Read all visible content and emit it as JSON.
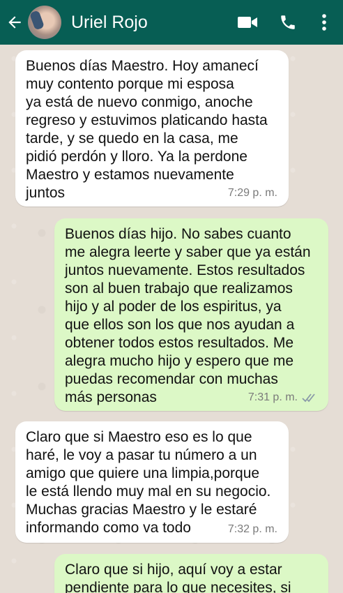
{
  "header": {
    "contact_name": "Uriel Rojo",
    "bg_color": "#075e54",
    "icons": [
      "back-arrow-icon",
      "avatar",
      "video-call-icon",
      "phone-icon",
      "more-vert-icon"
    ]
  },
  "messages": [
    {
      "direction": "incoming",
      "text": "Buenos días Maestro. Hoy amanecí\nmuy contento porque mi esposa\nya está de nuevo conmigo,  anoche\nregreso y estuvimos platicando hasta\ntarde, y se quedo en la casa, me\npidió perdón  y lloro. Ya la perdone\nMaestro y estamos nuevamente\njuntos",
      "time": "7:29 p. m."
    },
    {
      "direction": "outgoing",
      "text": "Buenos días hijo. No sabes cuanto\nme alegra leerte y saber que ya están\njuntos nuevamente. Estos resultados\nson al buen trabajo que realizamos\nhijo y al poder de los espiritus, ya\nque ellos son los que nos ayudan a\nobtener todos estos resultados. Me\nalegra mucho hijo y espero que me\npuedas recomendar con muchas\nmás personas",
      "time": "7:31 p. m.",
      "status": "read"
    },
    {
      "direction": "incoming",
      "text": "Claro que si Maestro eso es lo que\nharé, le voy a pasar tu número a un\namigo que quiere una limpia,porque\nle está llendo muy mal en su negocio.\nMuchas gracias Maestro y le estaré\ninformando como va todo",
      "time": "7:32 p. m."
    },
    {
      "direction": "outgoing",
      "text": "Claro que si hijo, aquí voy a estar\npendiente para lo que necesites, si",
      "time": ""
    }
  ],
  "colors": {
    "incoming_bubble": "#ffffff",
    "outgoing_bubble": "#dcf8c6",
    "wallpaper": "#e5ddd5",
    "read_ticks": "#8a9aa8"
  }
}
